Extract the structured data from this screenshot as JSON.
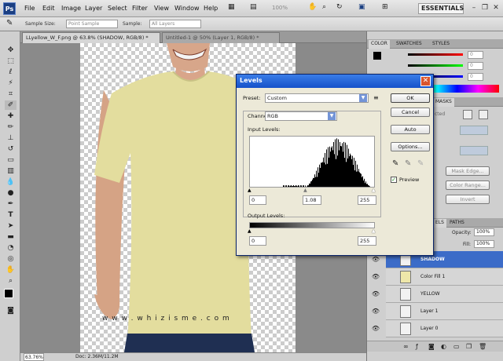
{
  "app": {
    "logo": "Ps",
    "workspace": "ESSENTIALS",
    "zoom": "100%"
  },
  "menu": [
    "File",
    "Edit",
    "Image",
    "Layer",
    "Select",
    "Filter",
    "View",
    "Window",
    "Help"
  ],
  "options_bar": {
    "sample_size_label": "Sample Size:",
    "sample_size_value": "Point Sample",
    "sample_label": "Sample:",
    "sample_value": "All Layers"
  },
  "doc_tabs": [
    "LLyellow_W_F.png @ 63.8% (SHADOW, RGB/8) *",
    "Untitled-1 @ 50% (Layer 1, RGB/8) *"
  ],
  "status": {
    "zoom": "63.76%",
    "doc": "Doc: 2.36M/11.2M"
  },
  "watermark": "w w w . w h i z i s m e . c o m",
  "panels": {
    "color_tabs": [
      "COLOR",
      "SWATCHES",
      "STYLES"
    ],
    "color_values": [
      "0",
      "0",
      "0"
    ],
    "masks_tab": "MASKS",
    "masks_partial": "cted",
    "mask_buttons": [
      "Mask Edge...",
      "Color Range...",
      "Invert"
    ],
    "layers_tabs": [
      "ELS",
      "PATHS"
    ],
    "opacity_label": "Opacity:",
    "opacity_value": "100%",
    "fill_label": "Fill:",
    "fill_value": "100%",
    "layers": [
      {
        "name": "SHADOW",
        "thumb": "#f2f2f2",
        "selected": true
      },
      {
        "name": "Color Fill 1",
        "thumb": "#eee7a9",
        "selected": false
      },
      {
        "name": "YELLOW",
        "thumb": "#f2f2f2",
        "selected": false
      },
      {
        "name": "Layer 1",
        "thumb": "#f2f2f2",
        "selected": false
      },
      {
        "name": "Layer 0",
        "thumb": "#f2f2f2",
        "selected": false
      }
    ]
  },
  "levels": {
    "title": "Levels",
    "preset_label": "Preset:",
    "preset_value": "Custom",
    "channel_label": "Channel:",
    "channel_value": "RGB",
    "input_levels_label": "Input Levels:",
    "input_black": "0",
    "input_gamma": "1.08",
    "input_white": "255",
    "output_levels_label": "Output Levels:",
    "output_black": "0",
    "output_white": "255",
    "buttons": {
      "ok": "OK",
      "cancel": "Cancel",
      "auto": "Auto",
      "options": "Options..."
    },
    "preview_label": "Preview",
    "preview_checked": true,
    "gamma_position": 0.45
  },
  "colors": {
    "shirt": "#e3dd9e",
    "titlebar": "#1551c9",
    "selected_layer": "#3c6cc8"
  }
}
